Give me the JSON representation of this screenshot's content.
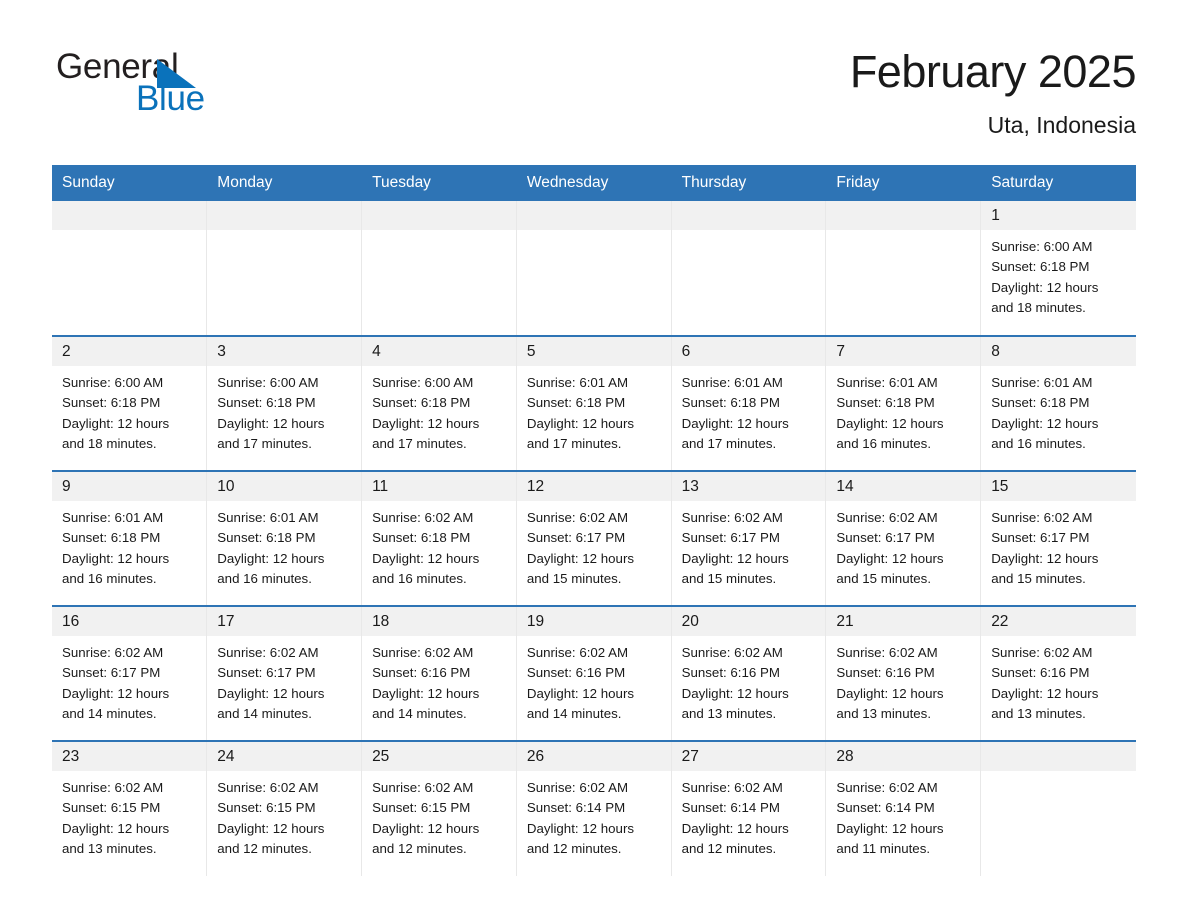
{
  "brand": {
    "name_dark": "General",
    "name_light": "Blue",
    "triangle_color": "#0a72bb"
  },
  "header": {
    "title": "February 2025",
    "location": "Uta, Indonesia",
    "header_bg": "#2e74b5",
    "row_border": "#2e74b5",
    "daynum_bg": "#f1f1f1"
  },
  "weekdays": [
    "Sunday",
    "Monday",
    "Tuesday",
    "Wednesday",
    "Thursday",
    "Friday",
    "Saturday"
  ],
  "weeks": [
    [
      {
        "day": "",
        "sunrise": "",
        "sunset": "",
        "daylight1": "",
        "daylight2": "",
        "blank": true
      },
      {
        "day": "",
        "sunrise": "",
        "sunset": "",
        "daylight1": "",
        "daylight2": "",
        "blank": true
      },
      {
        "day": "",
        "sunrise": "",
        "sunset": "",
        "daylight1": "",
        "daylight2": "",
        "blank": true
      },
      {
        "day": "",
        "sunrise": "",
        "sunset": "",
        "daylight1": "",
        "daylight2": "",
        "blank": true
      },
      {
        "day": "",
        "sunrise": "",
        "sunset": "",
        "daylight1": "",
        "daylight2": "",
        "blank": true
      },
      {
        "day": "",
        "sunrise": "",
        "sunset": "",
        "daylight1": "",
        "daylight2": "",
        "blank": true
      },
      {
        "day": "1",
        "sunrise": "Sunrise: 6:00 AM",
        "sunset": "Sunset: 6:18 PM",
        "daylight1": "Daylight: 12 hours",
        "daylight2": "and 18 minutes.",
        "blank": false
      }
    ],
    [
      {
        "day": "2",
        "sunrise": "Sunrise: 6:00 AM",
        "sunset": "Sunset: 6:18 PM",
        "daylight1": "Daylight: 12 hours",
        "daylight2": "and 18 minutes.",
        "blank": false
      },
      {
        "day": "3",
        "sunrise": "Sunrise: 6:00 AM",
        "sunset": "Sunset: 6:18 PM",
        "daylight1": "Daylight: 12 hours",
        "daylight2": "and 17 minutes.",
        "blank": false
      },
      {
        "day": "4",
        "sunrise": "Sunrise: 6:00 AM",
        "sunset": "Sunset: 6:18 PM",
        "daylight1": "Daylight: 12 hours",
        "daylight2": "and 17 minutes.",
        "blank": false
      },
      {
        "day": "5",
        "sunrise": "Sunrise: 6:01 AM",
        "sunset": "Sunset: 6:18 PM",
        "daylight1": "Daylight: 12 hours",
        "daylight2": "and 17 minutes.",
        "blank": false
      },
      {
        "day": "6",
        "sunrise": "Sunrise: 6:01 AM",
        "sunset": "Sunset: 6:18 PM",
        "daylight1": "Daylight: 12 hours",
        "daylight2": "and 17 minutes.",
        "blank": false
      },
      {
        "day": "7",
        "sunrise": "Sunrise: 6:01 AM",
        "sunset": "Sunset: 6:18 PM",
        "daylight1": "Daylight: 12 hours",
        "daylight2": "and 16 minutes.",
        "blank": false
      },
      {
        "day": "8",
        "sunrise": "Sunrise: 6:01 AM",
        "sunset": "Sunset: 6:18 PM",
        "daylight1": "Daylight: 12 hours",
        "daylight2": "and 16 minutes.",
        "blank": false
      }
    ],
    [
      {
        "day": "9",
        "sunrise": "Sunrise: 6:01 AM",
        "sunset": "Sunset: 6:18 PM",
        "daylight1": "Daylight: 12 hours",
        "daylight2": "and 16 minutes.",
        "blank": false
      },
      {
        "day": "10",
        "sunrise": "Sunrise: 6:01 AM",
        "sunset": "Sunset: 6:18 PM",
        "daylight1": "Daylight: 12 hours",
        "daylight2": "and 16 minutes.",
        "blank": false
      },
      {
        "day": "11",
        "sunrise": "Sunrise: 6:02 AM",
        "sunset": "Sunset: 6:18 PM",
        "daylight1": "Daylight: 12 hours",
        "daylight2": "and 16 minutes.",
        "blank": false
      },
      {
        "day": "12",
        "sunrise": "Sunrise: 6:02 AM",
        "sunset": "Sunset: 6:17 PM",
        "daylight1": "Daylight: 12 hours",
        "daylight2": "and 15 minutes.",
        "blank": false
      },
      {
        "day": "13",
        "sunrise": "Sunrise: 6:02 AM",
        "sunset": "Sunset: 6:17 PM",
        "daylight1": "Daylight: 12 hours",
        "daylight2": "and 15 minutes.",
        "blank": false
      },
      {
        "day": "14",
        "sunrise": "Sunrise: 6:02 AM",
        "sunset": "Sunset: 6:17 PM",
        "daylight1": "Daylight: 12 hours",
        "daylight2": "and 15 minutes.",
        "blank": false
      },
      {
        "day": "15",
        "sunrise": "Sunrise: 6:02 AM",
        "sunset": "Sunset: 6:17 PM",
        "daylight1": "Daylight: 12 hours",
        "daylight2": "and 15 minutes.",
        "blank": false
      }
    ],
    [
      {
        "day": "16",
        "sunrise": "Sunrise: 6:02 AM",
        "sunset": "Sunset: 6:17 PM",
        "daylight1": "Daylight: 12 hours",
        "daylight2": "and 14 minutes.",
        "blank": false
      },
      {
        "day": "17",
        "sunrise": "Sunrise: 6:02 AM",
        "sunset": "Sunset: 6:17 PM",
        "daylight1": "Daylight: 12 hours",
        "daylight2": "and 14 minutes.",
        "blank": false
      },
      {
        "day": "18",
        "sunrise": "Sunrise: 6:02 AM",
        "sunset": "Sunset: 6:16 PM",
        "daylight1": "Daylight: 12 hours",
        "daylight2": "and 14 minutes.",
        "blank": false
      },
      {
        "day": "19",
        "sunrise": "Sunrise: 6:02 AM",
        "sunset": "Sunset: 6:16 PM",
        "daylight1": "Daylight: 12 hours",
        "daylight2": "and 14 minutes.",
        "blank": false
      },
      {
        "day": "20",
        "sunrise": "Sunrise: 6:02 AM",
        "sunset": "Sunset: 6:16 PM",
        "daylight1": "Daylight: 12 hours",
        "daylight2": "and 13 minutes.",
        "blank": false
      },
      {
        "day": "21",
        "sunrise": "Sunrise: 6:02 AM",
        "sunset": "Sunset: 6:16 PM",
        "daylight1": "Daylight: 12 hours",
        "daylight2": "and 13 minutes.",
        "blank": false
      },
      {
        "day": "22",
        "sunrise": "Sunrise: 6:02 AM",
        "sunset": "Sunset: 6:16 PM",
        "daylight1": "Daylight: 12 hours",
        "daylight2": "and 13 minutes.",
        "blank": false
      }
    ],
    [
      {
        "day": "23",
        "sunrise": "Sunrise: 6:02 AM",
        "sunset": "Sunset: 6:15 PM",
        "daylight1": "Daylight: 12 hours",
        "daylight2": "and 13 minutes.",
        "blank": false
      },
      {
        "day": "24",
        "sunrise": "Sunrise: 6:02 AM",
        "sunset": "Sunset: 6:15 PM",
        "daylight1": "Daylight: 12 hours",
        "daylight2": "and 12 minutes.",
        "blank": false
      },
      {
        "day": "25",
        "sunrise": "Sunrise: 6:02 AM",
        "sunset": "Sunset: 6:15 PM",
        "daylight1": "Daylight: 12 hours",
        "daylight2": "and 12 minutes.",
        "blank": false
      },
      {
        "day": "26",
        "sunrise": "Sunrise: 6:02 AM",
        "sunset": "Sunset: 6:14 PM",
        "daylight1": "Daylight: 12 hours",
        "daylight2": "and 12 minutes.",
        "blank": false
      },
      {
        "day": "27",
        "sunrise": "Sunrise: 6:02 AM",
        "sunset": "Sunset: 6:14 PM",
        "daylight1": "Daylight: 12 hours",
        "daylight2": "and 12 minutes.",
        "blank": false
      },
      {
        "day": "28",
        "sunrise": "Sunrise: 6:02 AM",
        "sunset": "Sunset: 6:14 PM",
        "daylight1": "Daylight: 12 hours",
        "daylight2": "and 11 minutes.",
        "blank": false
      },
      {
        "day": "",
        "sunrise": "",
        "sunset": "",
        "daylight1": "",
        "daylight2": "",
        "blank": true
      }
    ]
  ]
}
